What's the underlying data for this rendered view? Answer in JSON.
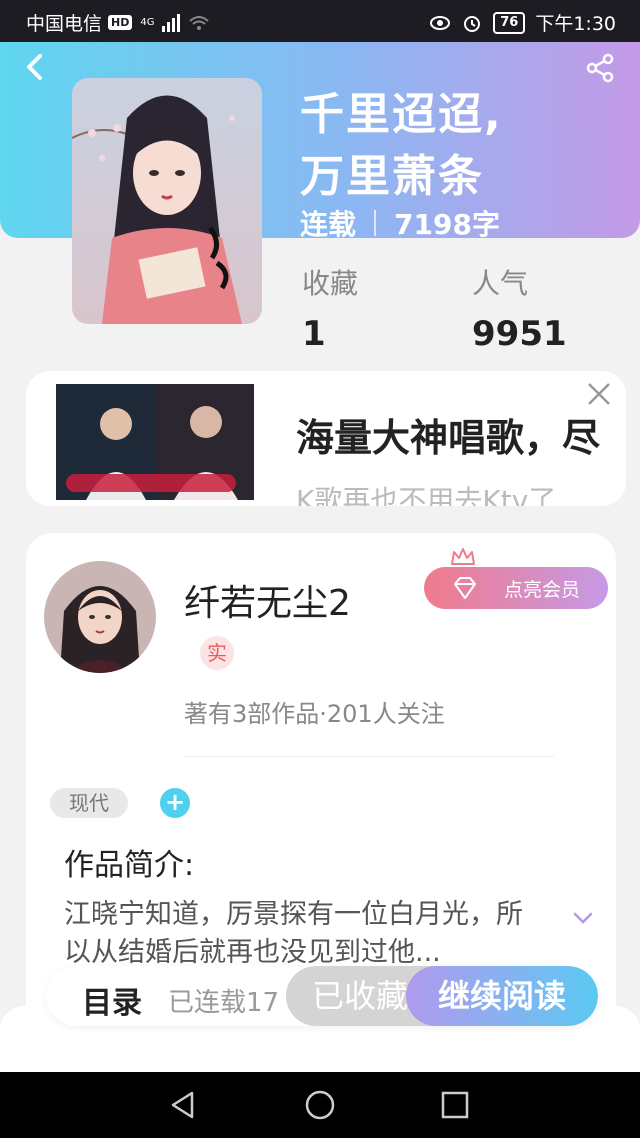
{
  "status_bar": {
    "carrier": "中国电信",
    "hd": "HD",
    "network": "4G",
    "battery": "76",
    "time": "下午1:30"
  },
  "book": {
    "title_line1": "千里迢迢,",
    "title_line2": "万里萧条",
    "status": "连载",
    "word_count": "7198字",
    "favorites_label": "收藏",
    "favorites_value": "1",
    "popularity_label": "人气",
    "popularity_value": "9951"
  },
  "ad": {
    "title": "海量大神唱歌，尽",
    "subtitle": "K歌再也不用去Ktv了"
  },
  "author": {
    "name": "纤若无尘2",
    "real_badge": "实",
    "vip_button": "点亮会员",
    "stats": "著有3部作品·201人关注"
  },
  "tags": [
    "现代"
  ],
  "add_tag": "+",
  "intro": {
    "title": "作品简介:",
    "text": "江晓宁知道，厉景探有一位白月光，所以从结婚后就再也没见到过他..."
  },
  "action_bar": {
    "toc": "目录",
    "chapter_count": "已连载17",
    "collected": "已收藏",
    "read": "继续阅读"
  },
  "colors": {
    "header_start": "#5fd6ef",
    "header_end": "#c49ae6",
    "accent_cyan": "#4fd0ef",
    "vip_start": "#f07a8c"
  }
}
